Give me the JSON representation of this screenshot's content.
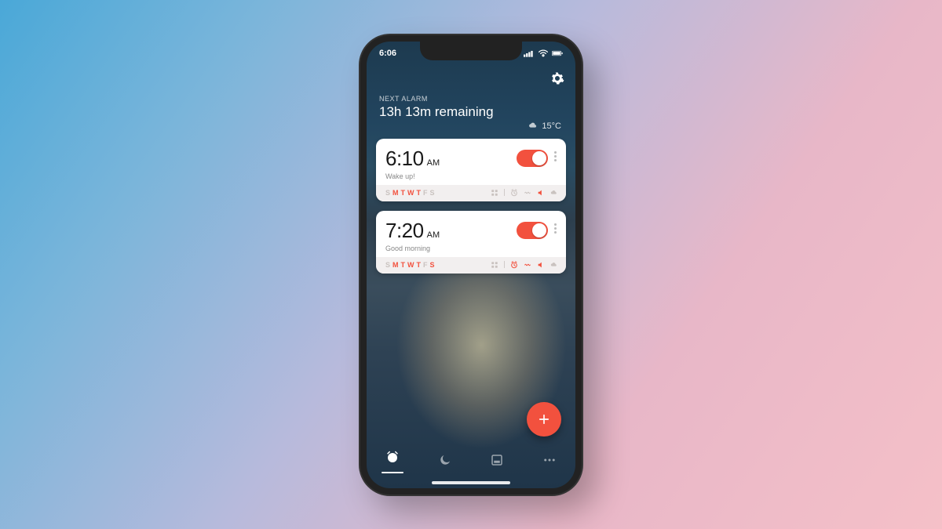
{
  "colors": {
    "accent": "#f2513e",
    "inactive_day": "#c9c2bf",
    "icon_dim": "#c9c2bf"
  },
  "status": {
    "time": "6:06"
  },
  "header": {
    "next_alarm_label": "NEXT ALARM",
    "remaining": "13h 13m remaining",
    "weather": "15°C"
  },
  "alarms": [
    {
      "time": "6:10",
      "ampm": "AM",
      "label": "Wake up!",
      "enabled": true,
      "days": [
        {
          "d": "S",
          "on": false
        },
        {
          "d": "M",
          "on": true
        },
        {
          "d": "T",
          "on": true
        },
        {
          "d": "W",
          "on": true
        },
        {
          "d": "T",
          "on": true
        },
        {
          "d": "F",
          "on": false
        },
        {
          "d": "S",
          "on": false
        }
      ],
      "features": {
        "snooze": false,
        "vibrate": false,
        "sound": true,
        "weather": false
      }
    },
    {
      "time": "7:20",
      "ampm": "AM",
      "label": "Good morning",
      "enabled": true,
      "days": [
        {
          "d": "S",
          "on": false
        },
        {
          "d": "M",
          "on": true
        },
        {
          "d": "T",
          "on": true
        },
        {
          "d": "W",
          "on": true
        },
        {
          "d": "T",
          "on": true
        },
        {
          "d": "F",
          "on": false
        },
        {
          "d": "S",
          "on": true
        }
      ],
      "features": {
        "snooze": true,
        "vibrate": true,
        "sound": true,
        "weather": false
      }
    }
  ],
  "tabs": [
    "alarms",
    "sleep",
    "notes",
    "more"
  ],
  "active_tab": 0
}
